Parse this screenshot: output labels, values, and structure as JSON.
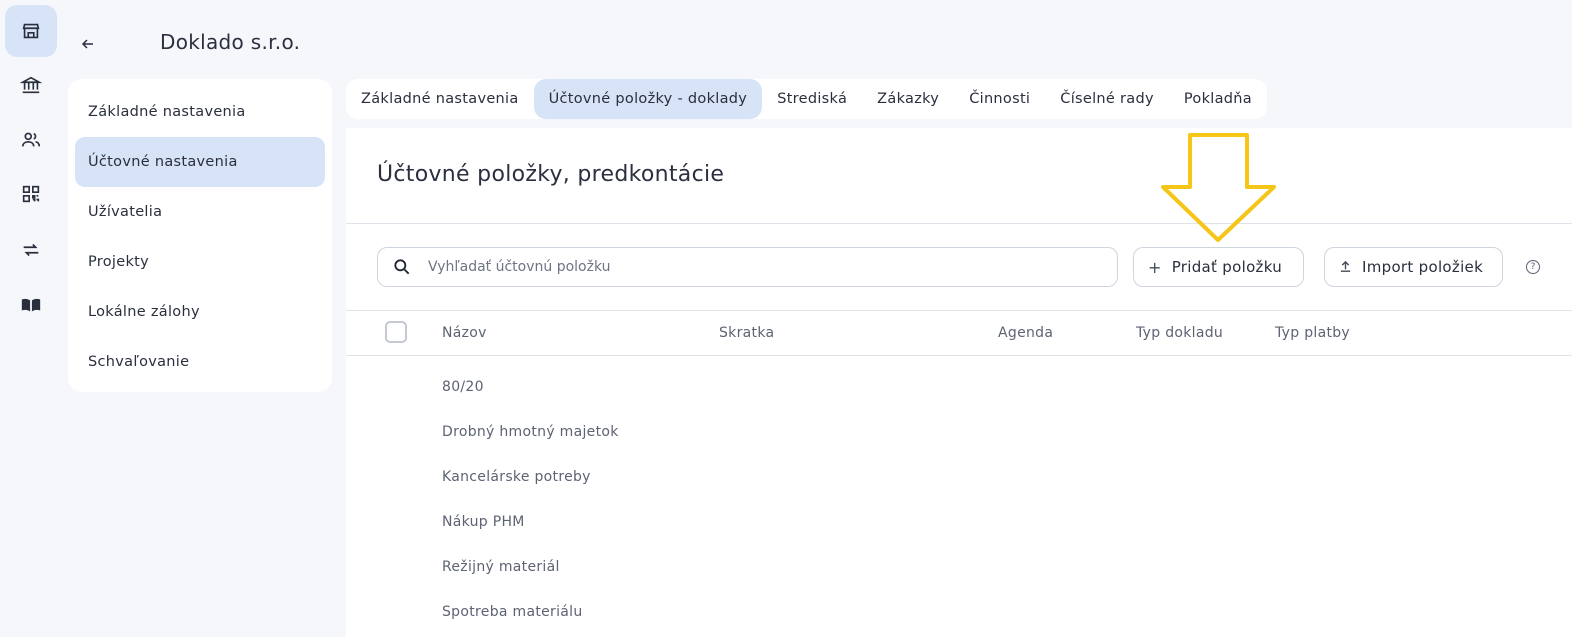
{
  "rail": {
    "icons": [
      "store-icon",
      "bank-icon",
      "people-icon",
      "qr-code-icon",
      "transfer-icon",
      "book-icon"
    ]
  },
  "header": {
    "company_name": "Doklado s.r.o."
  },
  "settings_nav": {
    "items": [
      {
        "label": "Základné nastavenia"
      },
      {
        "label": "Účtovné nastavenia"
      },
      {
        "label": "Užívatelia"
      },
      {
        "label": "Projekty"
      },
      {
        "label": "Lokálne zálohy"
      },
      {
        "label": "Schvaľovanie"
      }
    ],
    "active_index": 1
  },
  "tabs": {
    "items": [
      {
        "label": "Základné nastavenia"
      },
      {
        "label": "Účtovné položky - doklady"
      },
      {
        "label": "Strediská"
      },
      {
        "label": "Zákazky"
      },
      {
        "label": "Činnosti"
      },
      {
        "label": "Číselné rady"
      },
      {
        "label": "Pokladňa"
      }
    ],
    "active_index": 1
  },
  "main": {
    "title": "Účtovné položky, predkontácie",
    "search_placeholder": "Vyhľadať účtovnú položku",
    "add_button": "Pridať položku",
    "add_icon": "+",
    "import_button": "Import položiek",
    "import_icon": "upload-icon",
    "help_icon": "?",
    "table": {
      "columns": [
        "Názov",
        "Skratka",
        "Agenda",
        "Typ dokladu",
        "Typ platby"
      ],
      "rows": [
        "80/20",
        "Drobný hmotný majetok",
        "Kancelárske potreby",
        "Nákup PHM",
        "Režijný materiál",
        "Spotreba materiálu"
      ]
    }
  },
  "colors": {
    "accent_bg": "#d7e4f7",
    "annotation_arrow": "#f5c518"
  }
}
